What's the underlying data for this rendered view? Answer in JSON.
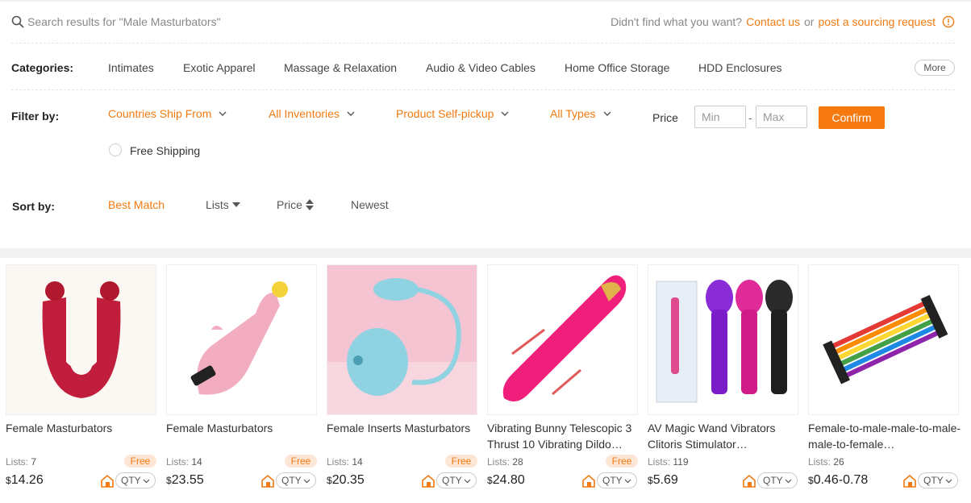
{
  "search": {
    "placeholder": "Search results for \"Male Masturbators\"",
    "not_found_text": "Didn't find what you want?",
    "contact_link": "Contact us",
    "or_text": "or",
    "sourcing_link": "post a sourcing request"
  },
  "categories": {
    "label": "Categories:",
    "items": [
      "Intimates",
      "Exotic Apparel",
      "Massage & Relaxation",
      "Audio & Video Cables",
      "Home Office Storage",
      "HDD Enclosures"
    ],
    "more_label": "More"
  },
  "filter": {
    "label": "Filter by:",
    "dropdowns": [
      "Countries Ship From",
      "All Inventories",
      "Product Self-pickup",
      "All Types"
    ],
    "price_label": "Price",
    "min_placeholder": "Min",
    "max_placeholder": "Max",
    "dash": "-",
    "confirm_label": "Confirm",
    "free_shipping_label": "Free Shipping"
  },
  "sort": {
    "label": "Sort by:",
    "options": [
      "Best Match",
      "Lists",
      "Price",
      "Newest"
    ],
    "active": "Best Match"
  },
  "products": [
    {
      "title": "Female Masturbators",
      "lists_label": "Lists:",
      "lists": "7",
      "free": "Free",
      "currency": "$",
      "price": "14.26",
      "qty": "QTY"
    },
    {
      "title": "Female Masturbators",
      "lists_label": "Lists:",
      "lists": "14",
      "free": "Free",
      "currency": "$",
      "price": "23.55",
      "qty": "QTY"
    },
    {
      "title": "Female Inserts Masturbators",
      "lists_label": "Lists:",
      "lists": "14",
      "free": "Free",
      "currency": "$",
      "price": "20.35",
      "qty": "QTY"
    },
    {
      "title": "Vibrating Bunny Telescopic 3 Thrust 10 Vibrating Dildo…",
      "lists_label": "Lists:",
      "lists": "28",
      "free": "Free",
      "currency": "$",
      "price": "24.80",
      "qty": "QTY"
    },
    {
      "title": "AV Magic Wand Vibrators Clitoris Stimulator…",
      "lists_label": "Lists:",
      "lists": "119",
      "free": "",
      "currency": "$",
      "price": "5.69",
      "qty": "QTY"
    },
    {
      "title": "Female-to-male-male-to-male-male-to-female…",
      "lists_label": "Lists:",
      "lists": "26",
      "free": "",
      "currency": "$",
      "price": "0.46-0.78",
      "qty": "QTY"
    }
  ],
  "colors": {
    "accent": "#f27a10",
    "confirm_bg": "#f5790f",
    "free_badge_bg": "#fde6d5"
  }
}
